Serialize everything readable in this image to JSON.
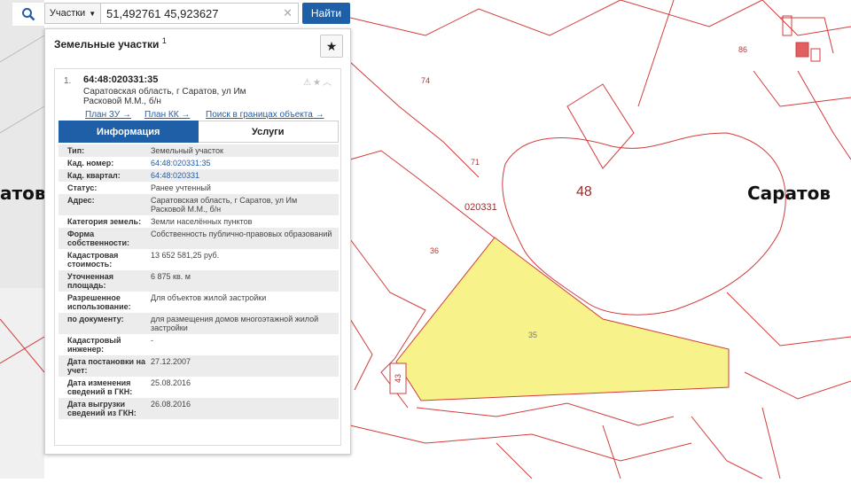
{
  "search": {
    "category": "Участки",
    "query": "51,492761 45,923627",
    "button": "Найти"
  },
  "panel": {
    "title": "Земельные участки",
    "count_sup": "1",
    "item": {
      "index": "1.",
      "cadastral_number": "64:48:020331:35",
      "address": "Саратовская область, г Саратов, ул Им Расковой М.М., б/н",
      "links": [
        "План ЗУ →",
        "План КК →",
        "Поиск в границах объекта →"
      ],
      "tabs": [
        "Информация",
        "Услуги"
      ],
      "rows": [
        {
          "key": "Тип:",
          "value": "Земельный участок"
        },
        {
          "key": "Кад. номер:",
          "value": "64:48:020331:35"
        },
        {
          "key": "Кад. квартал:",
          "value": "64:48:020331"
        },
        {
          "key": "Статус:",
          "value": "Ранее учтенный"
        },
        {
          "key": "Адрес:",
          "value": "Саратовская область, г Саратов, ул Им Расковой М.М., б/н"
        },
        {
          "key": "Категория земель:",
          "value": "Земли населённых пунктов"
        },
        {
          "key": "Форма собственности:",
          "value": "Собственность публично-правовых образований"
        },
        {
          "key": "Кадастровая стоимость:",
          "value": "13 652 581,25 руб."
        },
        {
          "key": "Уточненная площадь:",
          "value": "6 875 кв. м"
        },
        {
          "key": "Разрешенное использование:",
          "value": "Для объектов жилой застройки"
        },
        {
          "key": "по документу:",
          "value": "для размещения домов многоэтажной жилой застройки"
        },
        {
          "key": "Кадастровый инженер:",
          "value": "-"
        },
        {
          "key": "Дата постановки на учет:",
          "value": "27.12.2007"
        },
        {
          "key": "Дата изменения сведений в ГКН:",
          "value": "25.08.2016"
        },
        {
          "key": "Дата выгрузки сведений из ГКН:",
          "value": "26.08.2016"
        }
      ]
    }
  },
  "map": {
    "city_left": "атов",
    "city_right": "Саратов",
    "labels": [
      "74",
      "71",
      "48",
      "86",
      "020331",
      "36",
      "35",
      "43"
    ],
    "highlight_color": "#f7f28a",
    "boundary_color": "#d23c3c"
  }
}
